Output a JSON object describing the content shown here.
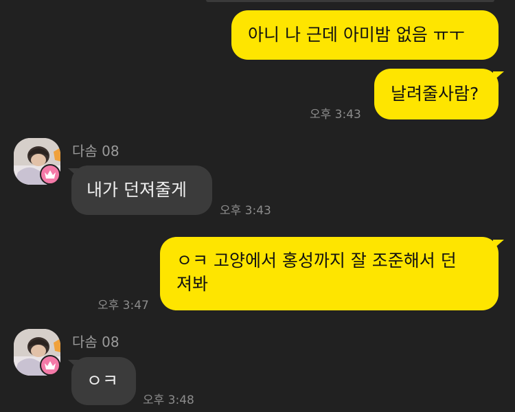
{
  "messages": [
    {
      "sender": "me",
      "text": "아니 나 근데 아미밤 없음 ㅠㅜ"
    },
    {
      "sender": "me",
      "text": "날려줄사람?",
      "time": "오후 3:43"
    },
    {
      "sender": "friend",
      "name": "다솜 08",
      "text": "내가 던져줄게",
      "time": "오후 3:43"
    },
    {
      "sender": "me",
      "text_line1": "ㅇㅋ 고양에서 홍성까지 잘 조준해서 던",
      "text_line2": "져봐",
      "time": "오후 3:47"
    },
    {
      "sender": "friend",
      "name": "다솜 08",
      "text": "ㅇㅋ",
      "time": "오후 3:48"
    }
  ],
  "colors": {
    "background": "#212121",
    "my_bubble": "#FEE500",
    "friend_bubble": "#3B3B3B",
    "badge": "#F47AA8"
  },
  "icons": {
    "friend_avatar": "profile-photo",
    "avatar_badge": "crown-icon"
  }
}
